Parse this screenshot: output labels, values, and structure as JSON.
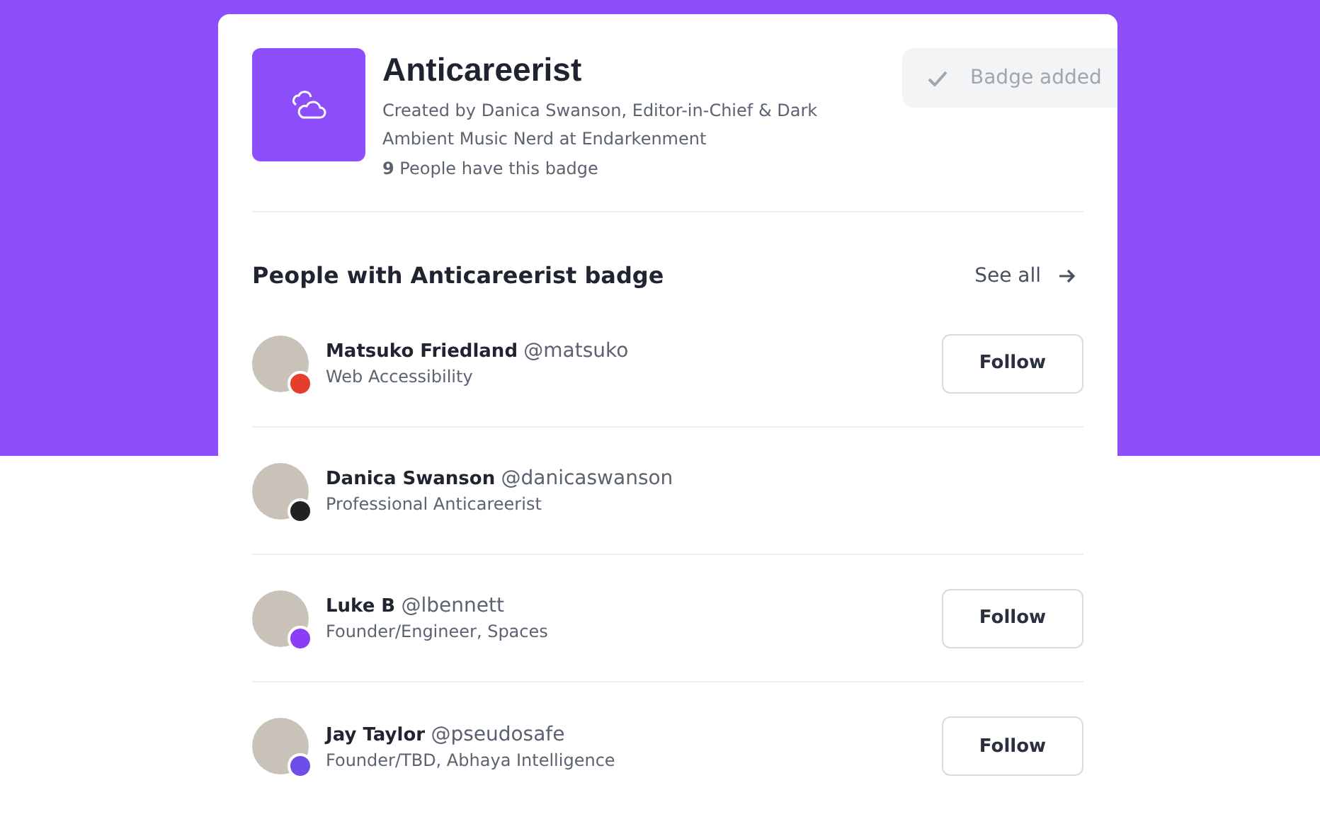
{
  "badge": {
    "title": "Anticareerist",
    "description": "Created by Danica Swanson, Editor-in-Chief & Dark Ambient Music Nerd at Endarkenment",
    "count_text": "**9** People have this badge",
    "action": {
      "label": "Badge added",
      "disabled": true
    }
  },
  "people_section": {
    "heading": "People with Anticareerist badge",
    "see_all": "See all"
  },
  "people": [
    {
      "name": "Matsuko Friedland",
      "handle": "@matsuko",
      "bio": "Web Accessibility",
      "color": "#e53e2e",
      "button": "Follow"
    },
    {
      "name": "Danica Swanson",
      "handle": "@danicaswanson",
      "bio": "Professional Anticareerist",
      "color": "#222222"
    },
    {
      "name": "Luke B",
      "handle": "@lbennett",
      "bio": "Founder/Engineer, Spaces",
      "color": "#8b3cf7",
      "button": "Follow"
    },
    {
      "name": "Jay Taylor",
      "handle": "@pseudosafe",
      "bio": "Founder/TBD, Abhaya Intelligence",
      "color": "#6d4ee8",
      "button": "Follow"
    }
  ]
}
